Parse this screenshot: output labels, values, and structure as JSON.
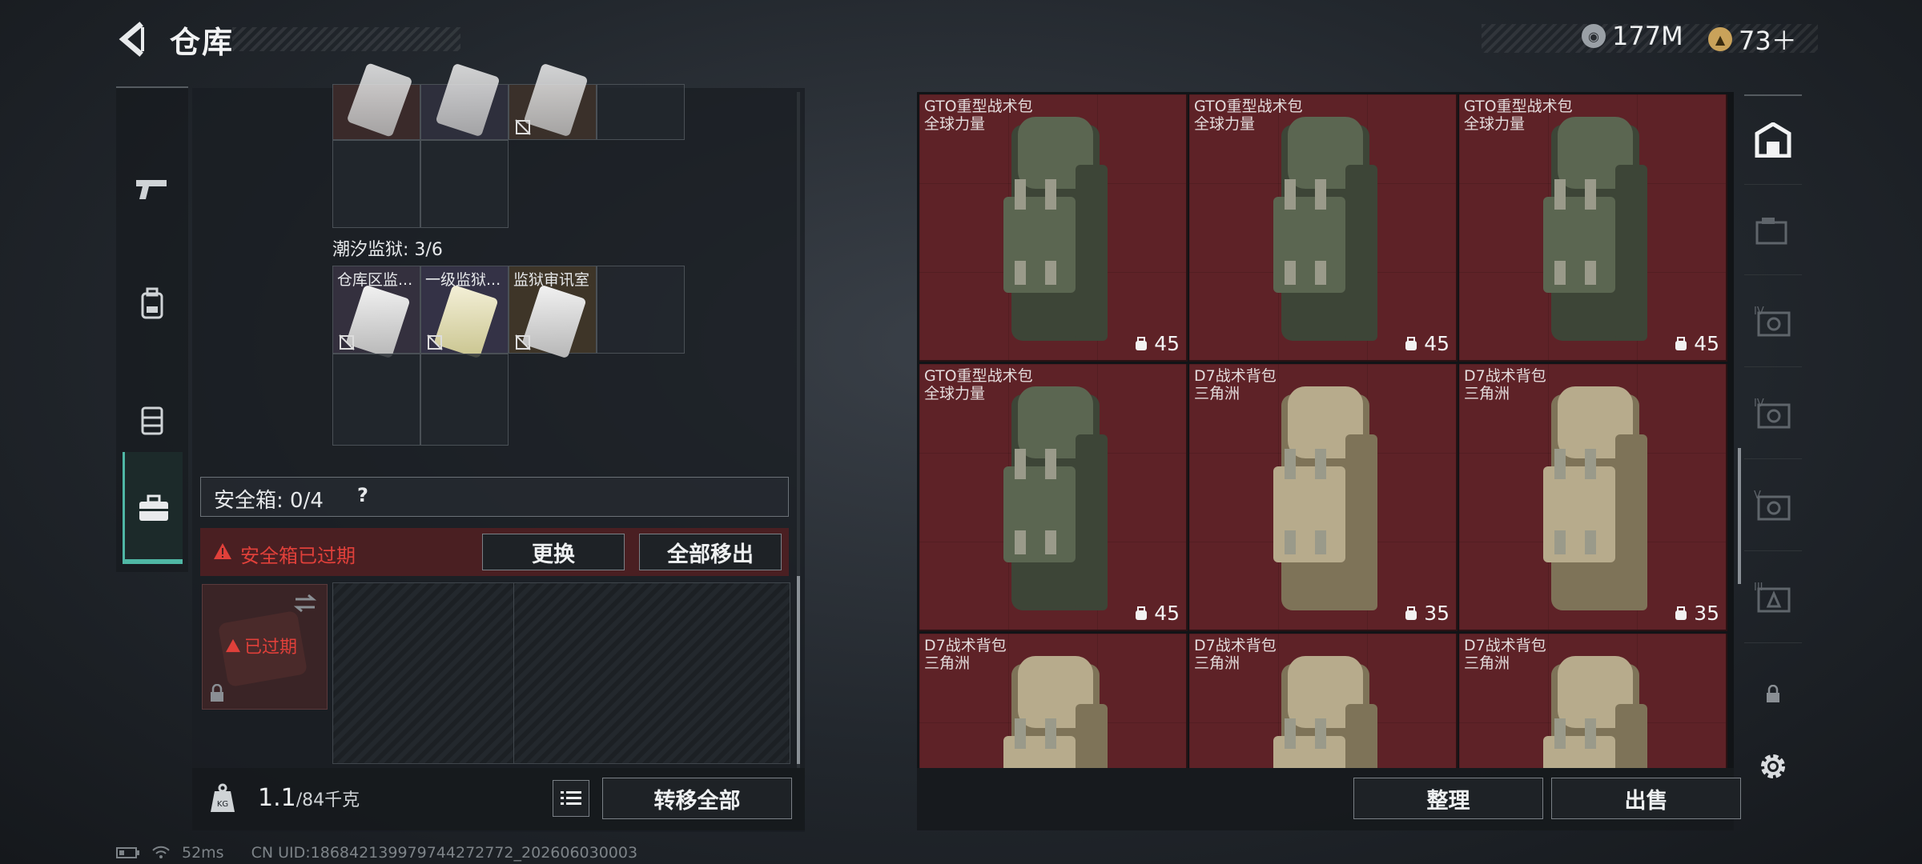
{
  "header": {
    "title": "仓库",
    "currency_main": "177M",
    "currency_secondary": "73＋"
  },
  "left": {
    "section_label": "潮汐监狱: 3/6",
    "items_row": [
      {
        "label": "仓库区监..."
      },
      {
        "label": "一级监狱..."
      },
      {
        "label": "监狱审讯室"
      }
    ],
    "safebox_label": "安全箱: 0/4",
    "safebox_help": "?",
    "expired_text": "安全箱已过期",
    "replace_button": "更换",
    "remove_all_button": "全部移出",
    "thumb_expired": "已过期",
    "weight_value": "1.1",
    "weight_max": "/84千克",
    "weight_icon_label": "KG",
    "transfer_all_button": "转移全部"
  },
  "items": [
    {
      "name": "GTO重型战术包",
      "sub": "全球力量",
      "capacity": "45",
      "color": "green"
    },
    {
      "name": "GTO重型战术包",
      "sub": "全球力量",
      "capacity": "45",
      "color": "green"
    },
    {
      "name": "GTO重型战术包",
      "sub": "全球力量",
      "capacity": "45",
      "color": "green"
    },
    {
      "name": "GTO重型战术包",
      "sub": "全球力量",
      "capacity": "45",
      "color": "green"
    },
    {
      "name": "D7战术背包",
      "sub": "三角洲",
      "capacity": "35",
      "color": "tan"
    },
    {
      "name": "D7战术背包",
      "sub": "三角洲",
      "capacity": "35",
      "color": "tan"
    },
    {
      "name": "D7战术背包",
      "sub": "三角洲",
      "capacity": "",
      "color": "tan"
    },
    {
      "name": "D7战术背包",
      "sub": "三角洲",
      "capacity": "",
      "color": "tan"
    },
    {
      "name": "D7战术背包",
      "sub": "三角洲",
      "capacity": "",
      "color": "tan"
    }
  ],
  "right": {
    "tier_labels": [
      "IV",
      "IV",
      "V",
      "III"
    ],
    "organize_button": "整理",
    "sell_button": "出售"
  },
  "status": {
    "ping": "52ms",
    "uid": "CN UID:1868421399797442727​72_202606030003"
  },
  "colors": {
    "accent": "#4fb7a5",
    "item_bg": "#5e2227",
    "expired": "#e0403a"
  }
}
